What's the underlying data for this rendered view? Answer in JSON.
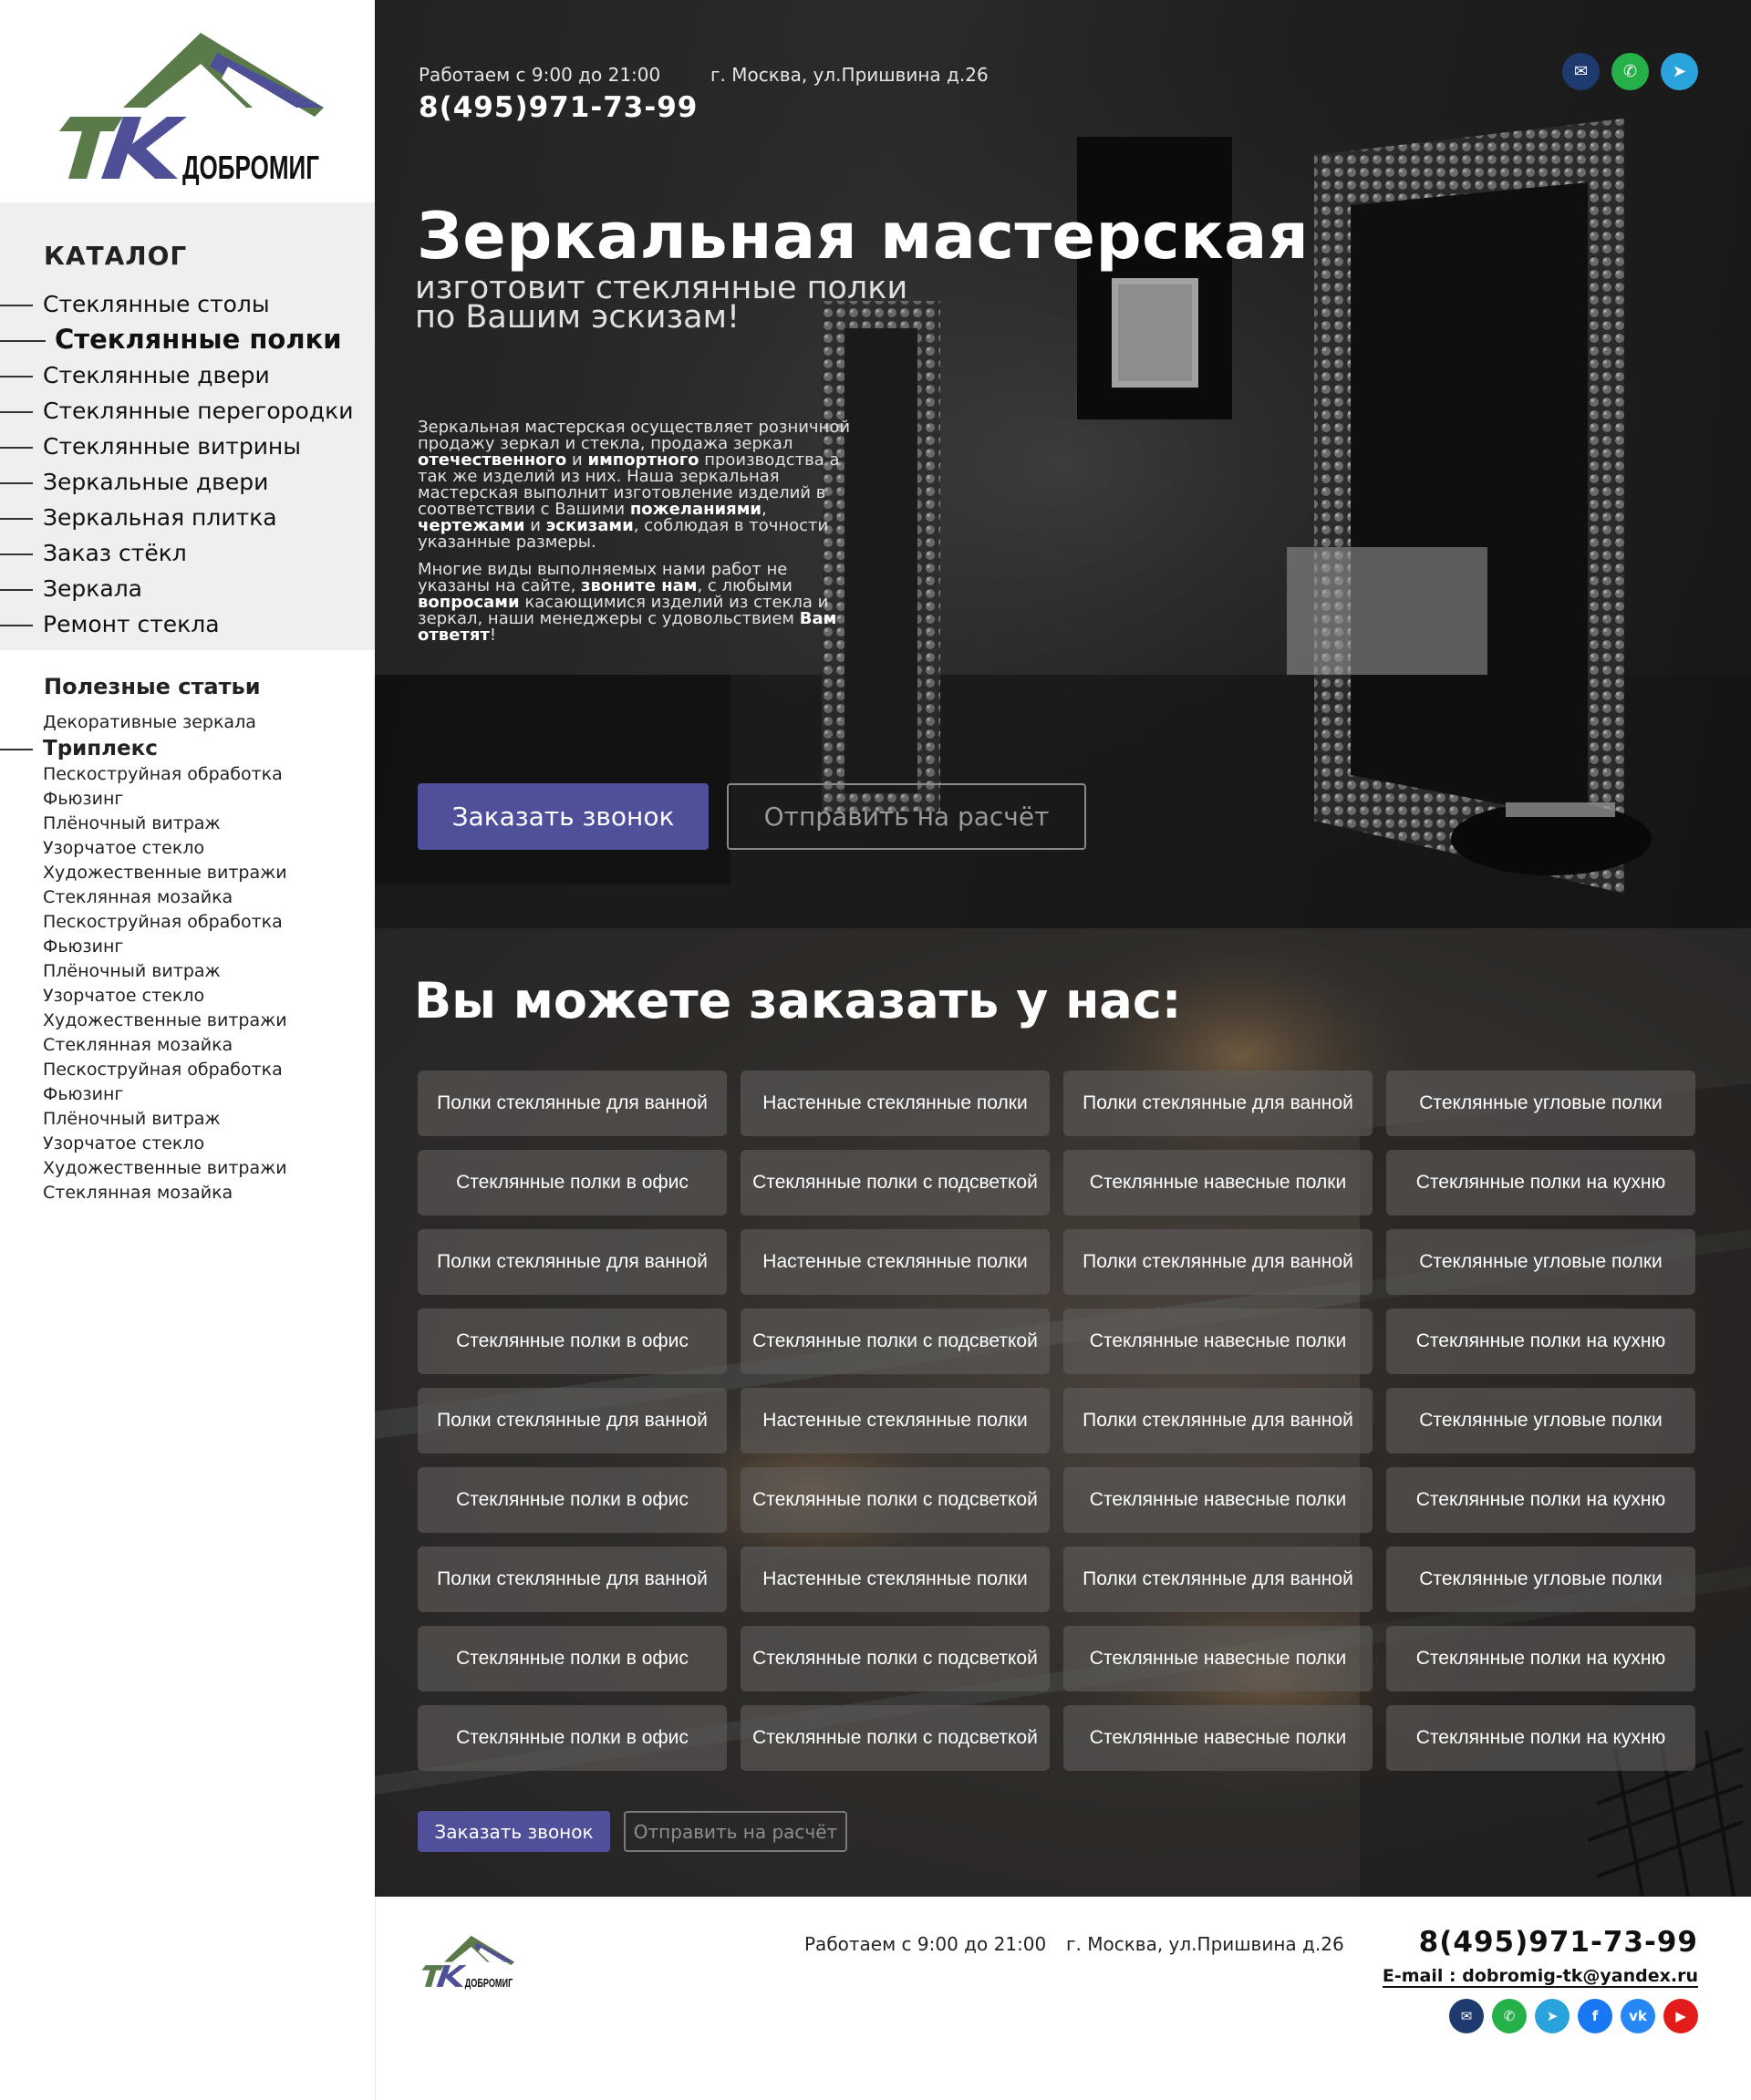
{
  "brand": {
    "logo_letters": "ТК",
    "logo_name": "ДОБРОМИГ"
  },
  "sidebar": {
    "catalog_title": "КАТАЛОГ",
    "catalog_items": [
      {
        "label": "Стеклянные столы",
        "active": false
      },
      {
        "label": "Стеклянные полки",
        "active": true
      },
      {
        "label": "Стеклянные двери",
        "active": false
      },
      {
        "label": "Стеклянные перегородки",
        "active": false
      },
      {
        "label": "Стеклянные витрины",
        "active": false
      },
      {
        "label": "Зеркальные двери",
        "active": false
      },
      {
        "label": "Зеркальная плитка",
        "active": false
      },
      {
        "label": "Заказ стёкл",
        "active": false
      },
      {
        "label": "Зеркала",
        "active": false
      },
      {
        "label": "Ремонт стекла",
        "active": false
      }
    ],
    "articles_title": "Полезные статьи",
    "article_items": [
      {
        "label": "Декоративные зеркала",
        "active": false
      },
      {
        "label": "Триплекс",
        "active": true
      },
      {
        "label": "Пескоструйная обработка",
        "active": false
      },
      {
        "label": "Фьюзинг",
        "active": false
      },
      {
        "label": "Плёночный витраж",
        "active": false
      },
      {
        "label": "Узорчатое стекло",
        "active": false
      },
      {
        "label": "Художественные витражи",
        "active": false
      },
      {
        "label": "Стеклянная мозайка",
        "active": false
      },
      {
        "label": "Пескоструйная обработка",
        "active": false
      },
      {
        "label": "Фьюзинг",
        "active": false
      },
      {
        "label": "Плёночный витраж",
        "active": false
      },
      {
        "label": "Узорчатое стекло",
        "active": false
      },
      {
        "label": "Художественные витражи",
        "active": false
      },
      {
        "label": "Стеклянная мозайка",
        "active": false
      },
      {
        "label": "Пескоструйная обработка",
        "active": false
      },
      {
        "label": "Фьюзинг",
        "active": false
      },
      {
        "label": "Плёночный витраж",
        "active": false
      },
      {
        "label": "Узорчатое стекло",
        "active": false
      },
      {
        "label": "Художественные витражи",
        "active": false
      },
      {
        "label": "Стеклянная мозайка",
        "active": false
      }
    ]
  },
  "header": {
    "hours": "Работаем с 9:00 до 21:00",
    "address": "г. Москва, ул.Пришвина д.26",
    "phone": "8(495)971-73-99",
    "social": [
      {
        "icon": "email-icon",
        "glyph": "✉",
        "color": "#1e3a6e"
      },
      {
        "icon": "whatsapp-icon",
        "glyph": "✆",
        "color": "#25b04a"
      },
      {
        "icon": "telegram-icon",
        "glyph": "➤",
        "color": "#2aa3dc"
      }
    ]
  },
  "hero": {
    "title": "Зеркальная мастерская",
    "subtitle_line1": "изготовит стеклянные полки",
    "subtitle_line2": "по Вашим эскизам!",
    "paragraph1_html": "Зеркальная мастерская осуществляет розничной продажу зеркал и стекла, продажа зеркал <b>отечественного</b> и <b>импортного</b> производства а так же изделий из них. Наша зеркальная мастерская выполнит изготовление изделий в соответствии с Вашими <b>пожеланиями</b>, <b>чертежами</b> и <b>эскизами</b>, соблюдая в точности указанные размеры.",
    "paragraph2_html": "Многие виды выполняемых нами работ не указаны на сайте, <b>звоните нам</b>, с любыми <b>вопросами</b> касающимися изделий из стекла и зеркал, наши менеджеры с удовольствием <b>Вам ответят</b>!",
    "call_button": "Заказать звонок",
    "calc_button": "Отправить на расчёт"
  },
  "services": {
    "title": "Вы можете заказать у нас:",
    "items": [
      "Полки стеклянные для ванной",
      "Настенные стеклянные полки",
      "Полки стеклянные для ванной",
      "Стеклянные угловые полки",
      "Стеклянные полки в офис",
      "Стеклянные полки с подсветкой",
      "Стеклянные навесные полки",
      "Стеклянные полки на кухню",
      "Полки стеклянные для ванной",
      "Настенные стеклянные полки",
      "Полки стеклянные для ванной",
      "Стеклянные угловые полки",
      "Стеклянные полки в офис",
      "Стеклянные полки с подсветкой",
      "Стеклянные навесные полки",
      "Стеклянные полки на кухню",
      "Полки стеклянные для ванной",
      "Настенные стеклянные полки",
      "Полки стеклянные для ванной",
      "Стеклянные угловые полки",
      "Стеклянные полки в офис",
      "Стеклянные полки с подсветкой",
      "Стеклянные навесные полки",
      "Стеклянные полки на кухню",
      "Полки стеклянные для ванной",
      "Настенные стеклянные полки",
      "Полки стеклянные для ванной",
      "Стеклянные угловые полки",
      "Стеклянные полки в офис",
      "Стеклянные полки с подсветкой",
      "Стеклянные навесные полки",
      "Стеклянные полки на кухню",
      "Стеклянные полки в офис",
      "Стеклянные полки с подсветкой",
      "Стеклянные навесные полки",
      "Стеклянные полки на кухню"
    ],
    "call_button": "Заказать звонок",
    "calc_button": "Отправить на расчёт"
  },
  "footer": {
    "hours": "Работаем с 9:00 до 21:00",
    "address": "г. Москва, ул.Пришвина д.26",
    "phone": "8(495)971-73-99",
    "email": "E-mail : dobromig-tk@yandex.ru",
    "social": [
      {
        "icon": "email-icon",
        "glyph": "✉",
        "color": "#1e3a6e"
      },
      {
        "icon": "whatsapp-icon",
        "glyph": "✆",
        "color": "#25b04a"
      },
      {
        "icon": "telegram-icon",
        "glyph": "➤",
        "color": "#2aa3dc"
      },
      {
        "icon": "facebook-icon",
        "glyph": "f",
        "color": "#1877f2"
      },
      {
        "icon": "vk-icon",
        "glyph": "vk",
        "color": "#2787f5"
      },
      {
        "icon": "youtube-icon",
        "glyph": "▶",
        "color": "#e21b1b"
      }
    ]
  },
  "colors": {
    "accent": "#50509a",
    "logo_green": "#5a7a4a",
    "logo_purple": "#4f4f98"
  }
}
